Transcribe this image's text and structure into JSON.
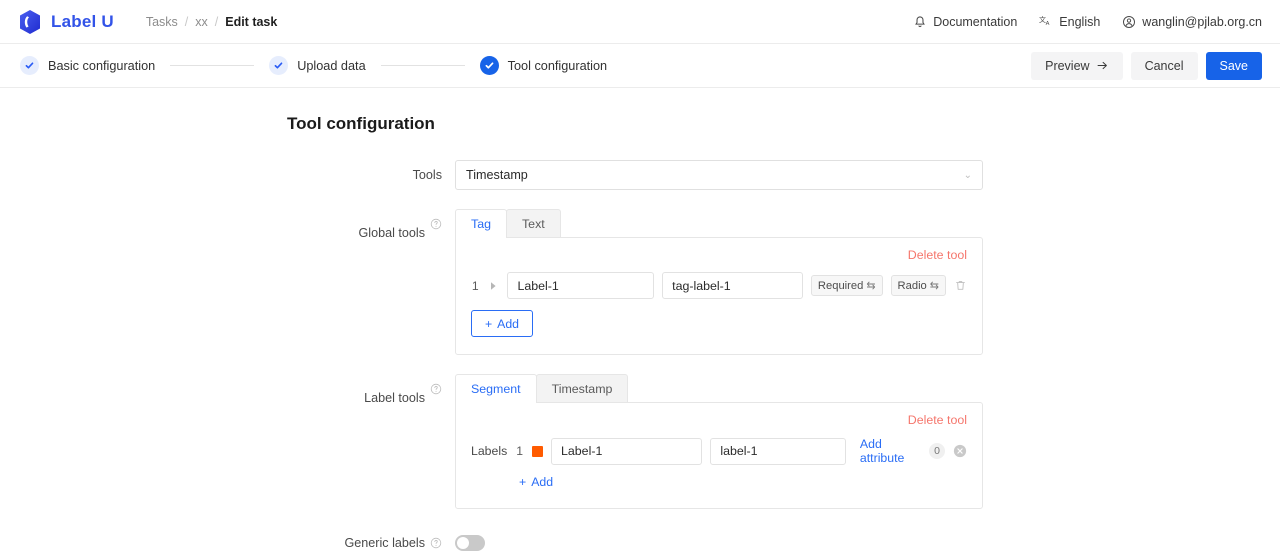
{
  "app": {
    "brand_name": "Label U",
    "logo_icon": "cube-logo-icon"
  },
  "breadcrumb": {
    "tasks": "Tasks",
    "sep": "/",
    "task_name": "xx",
    "current": "Edit task"
  },
  "topbar": {
    "documentation": "Documentation",
    "documentation_icon": "bell-icon",
    "language": "English",
    "language_icon": "translate-icon",
    "user": "wanglin@pjlab.org.cn",
    "user_icon": "user-circle-icon"
  },
  "steps": {
    "items": [
      {
        "label": "Basic configuration",
        "state": "done"
      },
      {
        "label": "Upload data",
        "state": "done"
      },
      {
        "label": "Tool configuration",
        "state": "active"
      }
    ],
    "preview_label": "Preview",
    "preview_icon": "arrow-right-icon",
    "cancel_label": "Cancel",
    "save_label": "Save"
  },
  "main": {
    "page_title": "Tool configuration",
    "tools": {
      "label": "Tools",
      "value": "Timestamp",
      "caret_icon": "chevron-down-icon"
    },
    "global_tools": {
      "label": "Global tools",
      "help_icon": "question-circle-icon",
      "tabs": [
        {
          "label": "Tag",
          "active": true
        },
        {
          "label": "Text",
          "active": false
        }
      ],
      "delete_tool": "Delete tool",
      "rows": [
        {
          "index": "1",
          "expander_icon": "caret-right-icon",
          "name_value": "Label-1",
          "key_value": "tag-label-1",
          "required_label": "Required",
          "required_icon": "swap-icon",
          "type_label": "Radio",
          "type_icon": "swap-icon",
          "delete_icon": "trash-icon"
        }
      ],
      "add_label": "Add",
      "add_icon": "plus-icon"
    },
    "label_tools": {
      "label": "Label tools",
      "help_icon": "question-circle-icon",
      "tabs": [
        {
          "label": "Segment",
          "active": true
        },
        {
          "label": "Timestamp",
          "active": false
        }
      ],
      "delete_tool": "Delete tool",
      "labels_word": "Labels",
      "rows": [
        {
          "index": "1",
          "color": "#ff5b00",
          "name_value": "Label-1",
          "key_value": "label-1",
          "add_attribute": "Add attribute",
          "attribute_count": "0",
          "remove_icon": "close-circle-icon"
        }
      ],
      "add_label": "Add",
      "add_icon": "plus-icon"
    },
    "generic_labels": {
      "label": "Generic labels",
      "help_icon": "question-circle-icon",
      "enabled": false
    }
  },
  "colors": {
    "brand": "#3253e8",
    "primary": "#1763e8",
    "link": "#2a6df5",
    "danger": "#f5766c",
    "swatch": "#ff5b00"
  }
}
